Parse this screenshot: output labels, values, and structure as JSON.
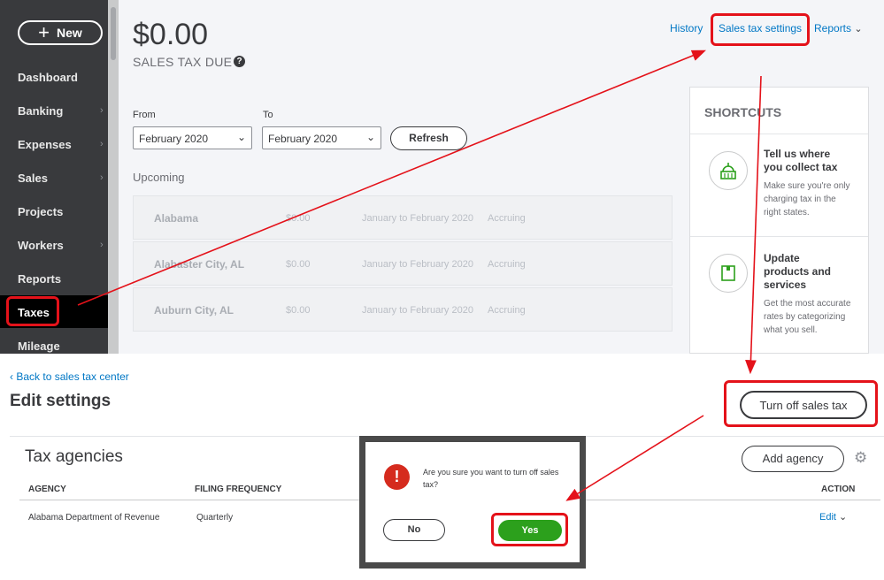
{
  "sidebar": {
    "new_label": "New",
    "items": [
      "Dashboard",
      "Banking",
      "Expenses",
      "Sales",
      "Projects",
      "Workers",
      "Reports",
      "Taxes",
      "Mileage"
    ],
    "active": "Taxes"
  },
  "header": {
    "amount": "$0.00",
    "due_label": "SALES TAX DUE",
    "history": "History",
    "sales_tax_settings": "Sales tax settings",
    "reports": "Reports"
  },
  "filters": {
    "from_label": "From",
    "from_value": "February 2020",
    "to_label": "To",
    "to_value": "February 2020",
    "refresh": "Refresh"
  },
  "upcoming": {
    "title": "Upcoming",
    "rows": [
      {
        "name": "Alabama",
        "amount": "$0.00",
        "period": "January to February 2020",
        "status": "Accruing"
      },
      {
        "name": "Alabaster City, AL",
        "amount": "$0.00",
        "period": "January to February 2020",
        "status": "Accruing"
      },
      {
        "name": "Auburn City, AL",
        "amount": "$0.00",
        "period": "January to February 2020",
        "status": "Accruing"
      }
    ]
  },
  "shortcuts": {
    "title": "SHORTCUTS",
    "items": [
      {
        "title": "Tell us where you collect tax",
        "desc": "Make sure you're only charging tax in the right states."
      },
      {
        "title": "Update products and services",
        "desc": "Get the most accurate rates by categorizing what you sell."
      }
    ]
  },
  "settings": {
    "back_link": "Back to sales tax center",
    "title": "Edit settings",
    "turn_off": "Turn off sales tax"
  },
  "agencies": {
    "title": "Tax agencies",
    "add_agency": "Add agency",
    "columns": {
      "agency": "AGENCY",
      "frequency": "FILING FREQUENCY",
      "action": "ACTION"
    },
    "rows": [
      {
        "agency": "Alabama Department of Revenue",
        "frequency": "Quarterly",
        "action": "Edit"
      }
    ]
  },
  "dialog": {
    "message": "Are you sure you want to turn off sales tax?",
    "no": "No",
    "yes": "Yes"
  },
  "colors": {
    "accent_green": "#2ca01c",
    "link_blue": "#0077c5",
    "highlight_red": "#e4121a"
  }
}
